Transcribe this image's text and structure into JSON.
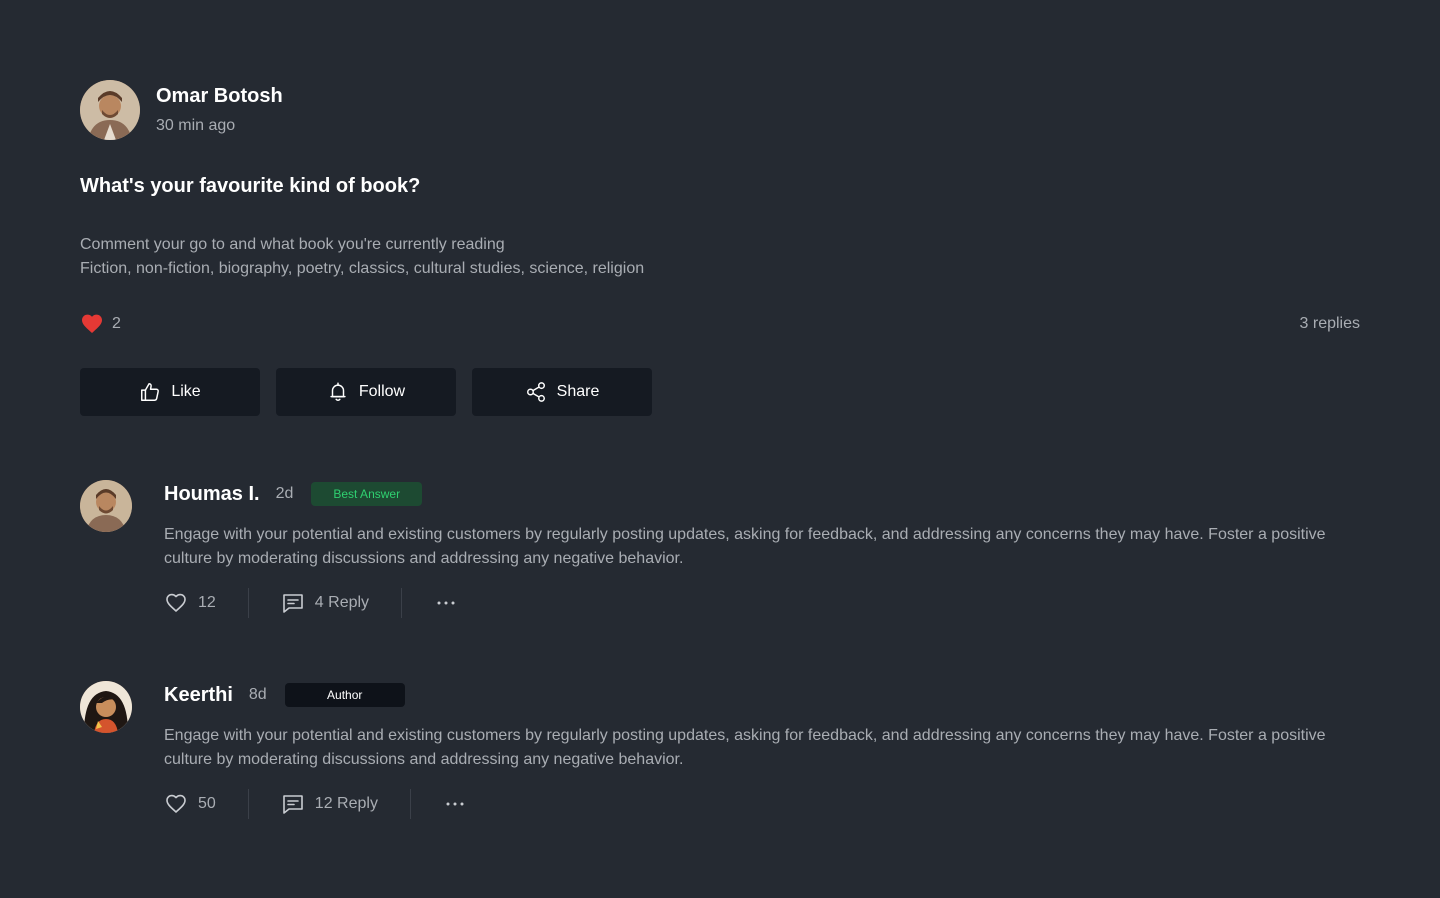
{
  "post": {
    "author": {
      "name": "Omar Botosh",
      "time": "30 min ago"
    },
    "title": "What's your favourite kind of book?",
    "body_lines": [
      "Comment your go to and what book you're currently reading",
      "Fiction, non-fiction, biography, poetry, classics, cultural studies, science, religion"
    ],
    "likes": "2",
    "replies": "3 replies",
    "actions": {
      "like": "Like",
      "follow": "Follow",
      "share": "Share"
    }
  },
  "comments": [
    {
      "name": "Houmas I.",
      "age": "2d",
      "badge": "Best Answer",
      "text": "Engage with your potential and existing customers by regularly posting updates, asking for feedback, and addressing any concerns they may have. Foster a positive culture by moderating discussions and addressing any negative behavior.",
      "likes": "12",
      "reply": "4 Reply"
    },
    {
      "name": "Keerthi",
      "age": "8d",
      "badge": "Author",
      "text": "Engage with your potential and existing customers by regularly posting updates, asking for feedback, and addressing any concerns they may have. Foster a positive culture by moderating discussions and addressing any negative behavior.",
      "likes": "50",
      "reply": "12 Reply"
    }
  ],
  "colors": {
    "background": "#252a32",
    "button_bg": "#151a22",
    "muted_text": "#a9adb3",
    "heart": "#e53935",
    "best_answer_bg": "#1d4a32",
    "best_answer_text": "#2fd070"
  },
  "icons": {
    "like": "thumbs-up-icon",
    "follow": "bell-icon",
    "share": "share-icon",
    "heart": "heart-icon",
    "reply": "comment-icon",
    "more": "more-horizontal-icon"
  }
}
